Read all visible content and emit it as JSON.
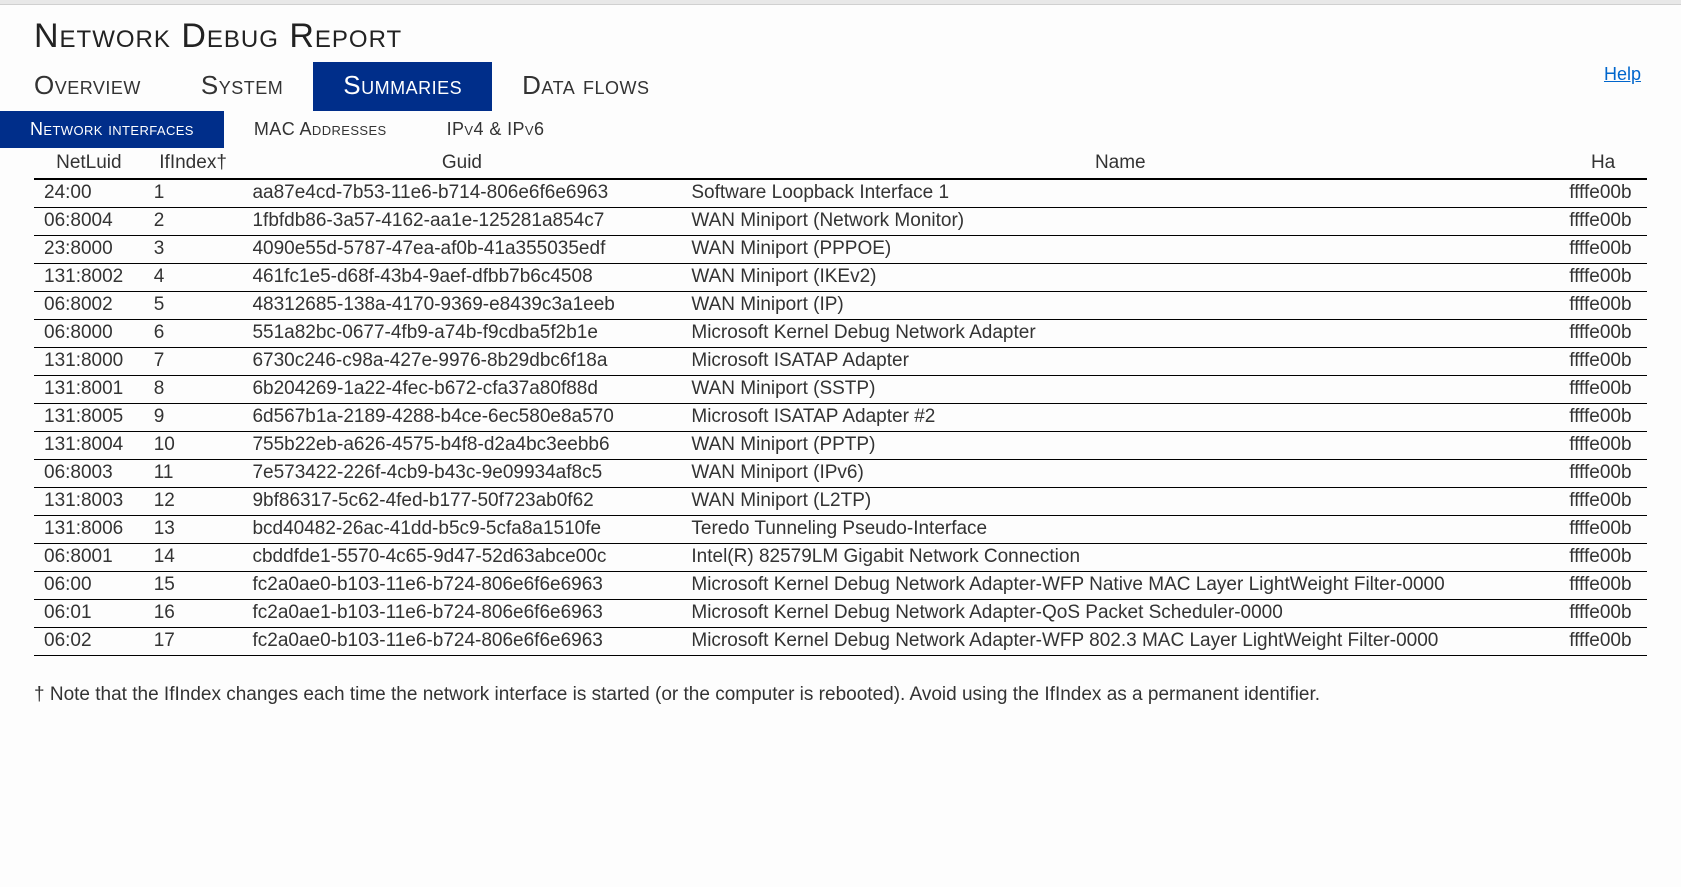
{
  "title": "Network Debug Report",
  "tabs": [
    {
      "label": "Overview",
      "active": false
    },
    {
      "label": "System",
      "active": false
    },
    {
      "label": "Summaries",
      "active": true
    },
    {
      "label": "Data flows",
      "active": false
    }
  ],
  "help_label": "Help",
  "subtabs": [
    {
      "label": "Network interfaces",
      "active": true
    },
    {
      "label": "MAC Addresses",
      "active": false
    },
    {
      "label": "IPv4 & IPv6",
      "active": false
    }
  ],
  "columns": {
    "netluid": "NetLuid",
    "ifindex": "IfIndex†",
    "guid": "Guid",
    "name": "Name",
    "ha": "Ha"
  },
  "rows": [
    {
      "netluid": "24:00",
      "ifindex": "1",
      "guid": "aa87e4cd-7b53-11e6-b714-806e6f6e6963",
      "name": "Software Loopback Interface 1",
      "ha": "ffffe00b"
    },
    {
      "netluid": "06:8004",
      "ifindex": "2",
      "guid": "1fbfdb86-3a57-4162-aa1e-125281a854c7",
      "name": "WAN Miniport (Network Monitor)",
      "ha": "ffffe00b"
    },
    {
      "netluid": "23:8000",
      "ifindex": "3",
      "guid": "4090e55d-5787-47ea-af0b-41a355035edf",
      "name": "WAN Miniport (PPPOE)",
      "ha": "ffffe00b"
    },
    {
      "netluid": "131:8002",
      "ifindex": "4",
      "guid": "461fc1e5-d68f-43b4-9aef-dfbb7b6c4508",
      "name": "WAN Miniport (IKEv2)",
      "ha": "ffffe00b"
    },
    {
      "netluid": "06:8002",
      "ifindex": "5",
      "guid": "48312685-138a-4170-9369-e8439c3a1eeb",
      "name": "WAN Miniport (IP)",
      "ha": "ffffe00b"
    },
    {
      "netluid": "06:8000",
      "ifindex": "6",
      "guid": "551a82bc-0677-4fb9-a74b-f9cdba5f2b1e",
      "name": "Microsoft Kernel Debug Network Adapter",
      "ha": "ffffe00b"
    },
    {
      "netluid": "131:8000",
      "ifindex": "7",
      "guid": "6730c246-c98a-427e-9976-8b29dbc6f18a",
      "name": "Microsoft ISATAP Adapter",
      "ha": "ffffe00b"
    },
    {
      "netluid": "131:8001",
      "ifindex": "8",
      "guid": "6b204269-1a22-4fec-b672-cfa37a80f88d",
      "name": "WAN Miniport (SSTP)",
      "ha": "ffffe00b"
    },
    {
      "netluid": "131:8005",
      "ifindex": "9",
      "guid": "6d567b1a-2189-4288-b4ce-6ec580e8a570",
      "name": "Microsoft ISATAP Adapter #2",
      "ha": "ffffe00b"
    },
    {
      "netluid": "131:8004",
      "ifindex": "10",
      "guid": "755b22eb-a626-4575-b4f8-d2a4bc3eebb6",
      "name": "WAN Miniport (PPTP)",
      "ha": "ffffe00b"
    },
    {
      "netluid": "06:8003",
      "ifindex": "11",
      "guid": "7e573422-226f-4cb9-b43c-9e09934af8c5",
      "name": "WAN Miniport (IPv6)",
      "ha": "ffffe00b"
    },
    {
      "netluid": "131:8003",
      "ifindex": "12",
      "guid": "9bf86317-5c62-4fed-b177-50f723ab0f62",
      "name": "WAN Miniport (L2TP)",
      "ha": "ffffe00b"
    },
    {
      "netluid": "131:8006",
      "ifindex": "13",
      "guid": "bcd40482-26ac-41dd-b5c9-5cfa8a1510fe",
      "name": "Teredo Tunneling Pseudo-Interface",
      "ha": "ffffe00b"
    },
    {
      "netluid": "06:8001",
      "ifindex": "14",
      "guid": "cbddfde1-5570-4c65-9d47-52d63abce00c",
      "name": "Intel(R) 82579LM Gigabit Network Connection",
      "ha": "ffffe00b"
    },
    {
      "netluid": "06:00",
      "ifindex": "15",
      "guid": "fc2a0ae0-b103-11e6-b724-806e6f6e6963",
      "name": "Microsoft Kernel Debug Network Adapter-WFP Native MAC Layer LightWeight Filter-0000",
      "ha": "ffffe00b"
    },
    {
      "netluid": "06:01",
      "ifindex": "16",
      "guid": "fc2a0ae1-b103-11e6-b724-806e6f6e6963",
      "name": "Microsoft Kernel Debug Network Adapter-QoS Packet Scheduler-0000",
      "ha": "ffffe00b"
    },
    {
      "netluid": "06:02",
      "ifindex": "17",
      "guid": "fc2a0ae0-b103-11e6-b724-806e6f6e6963",
      "name": "Microsoft Kernel Debug Network Adapter-WFP 802.3 MAC Layer LightWeight Filter-0000",
      "ha": "ffffe00b"
    }
  ],
  "footnote": "† Note that the IfIndex changes each time the network interface is started (or the computer is rebooted). Avoid using the IfIndex as a permanent identifier."
}
